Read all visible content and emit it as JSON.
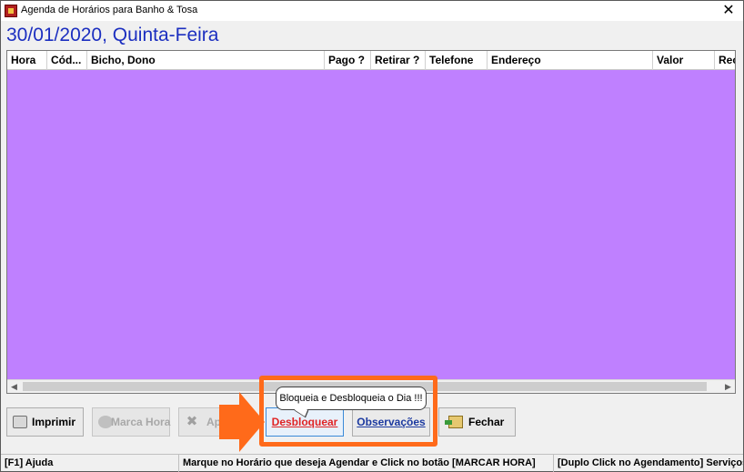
{
  "window": {
    "title": "Agenda de Horários para Banho & Tosa",
    "close_glyph": "✕"
  },
  "date_header": "30/01/2020, Quinta-Feira",
  "grid": {
    "background_color": "#bf80ff",
    "columns": [
      "Hora",
      "Cód...",
      "Bicho, Dono",
      "Pago ?",
      "Retirar ?",
      "Telefone",
      "Endereço",
      "Valor",
      "Rec"
    ],
    "rows": []
  },
  "toolbar": {
    "print_label": "Imprimir",
    "book_label": "Marca Hora",
    "delete_label": "Ap",
    "unlock_label": "Desbloquear",
    "notes_label": "Observações",
    "close_label": "Fechar"
  },
  "tooltip": "Bloqueia e Desbloqueia o Dia !!!",
  "highlight_color": "#ff6a1a",
  "status": {
    "help": "[F1] Ajuda",
    "instruction": "Marque no Horário que deseja Agendar e Click no botão [MARCAR HORA]",
    "services": "[Duplo Click no Agendamento] Serviços"
  }
}
